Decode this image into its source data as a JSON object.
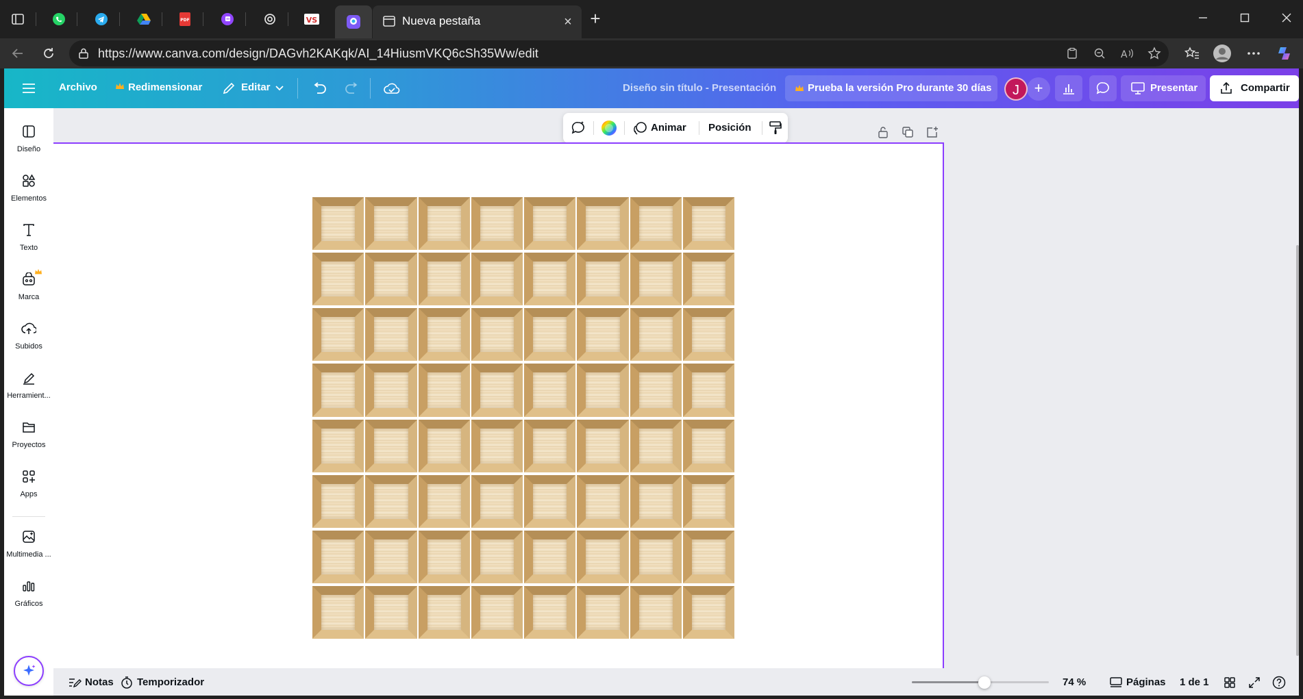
{
  "browser": {
    "active_tab_title": "Nueva pestaña",
    "pinned_tabs": [
      "whatsapp-icon",
      "telegram-icon",
      "google-drive-icon",
      "pdf-icon",
      "twitch-icon",
      "openai-icon",
      "vs-icon",
      "canva-icon"
    ],
    "url": "https://www.canva.com/design/DAGvh2KAKqk/AI_14HiusmVKQ6cSh35Ww/edit",
    "avatar_initial": "J"
  },
  "header": {
    "menu_file": "Archivo",
    "resize": "Redimensionar",
    "edit": "Editar",
    "doc_title": "Diseño sin título - Presentación",
    "pro_trial": "Prueba la versión Pro durante 30 días",
    "user_initial": "J",
    "add_person": "+",
    "present": "Presentar",
    "share": "Compartir",
    "accent_color": "#8b3dff",
    "crown_color": "#ffb020"
  },
  "context_toolbar": {
    "animate": "Animar",
    "position": "Posición"
  },
  "sidebar": {
    "items": [
      {
        "label": "Diseño",
        "icon": "layout-icon"
      },
      {
        "label": "Elementos",
        "icon": "elements-icon"
      },
      {
        "label": "Texto",
        "icon": "text-icon"
      },
      {
        "label": "Marca",
        "icon": "brand-icon"
      },
      {
        "label": "Subidos",
        "icon": "upload-icon"
      },
      {
        "label": "Herramient...",
        "icon": "draw-icon"
      },
      {
        "label": "Proyectos",
        "icon": "folder-icon"
      },
      {
        "label": "Apps",
        "icon": "apps-icon"
      },
      {
        "label": "Multimedia ...",
        "icon": "media-icon"
      },
      {
        "label": "Gráficos",
        "icon": "chart-icon"
      }
    ]
  },
  "canvas": {
    "grid_rows": 8,
    "grid_cols": 8,
    "element": "wooden-crate"
  },
  "footer": {
    "notes": "Notas",
    "timer": "Temporizador",
    "zoom_value": "74 %",
    "zoom_fraction": 0.53,
    "pages_label": "Páginas",
    "page_counter": "1 de 1"
  }
}
